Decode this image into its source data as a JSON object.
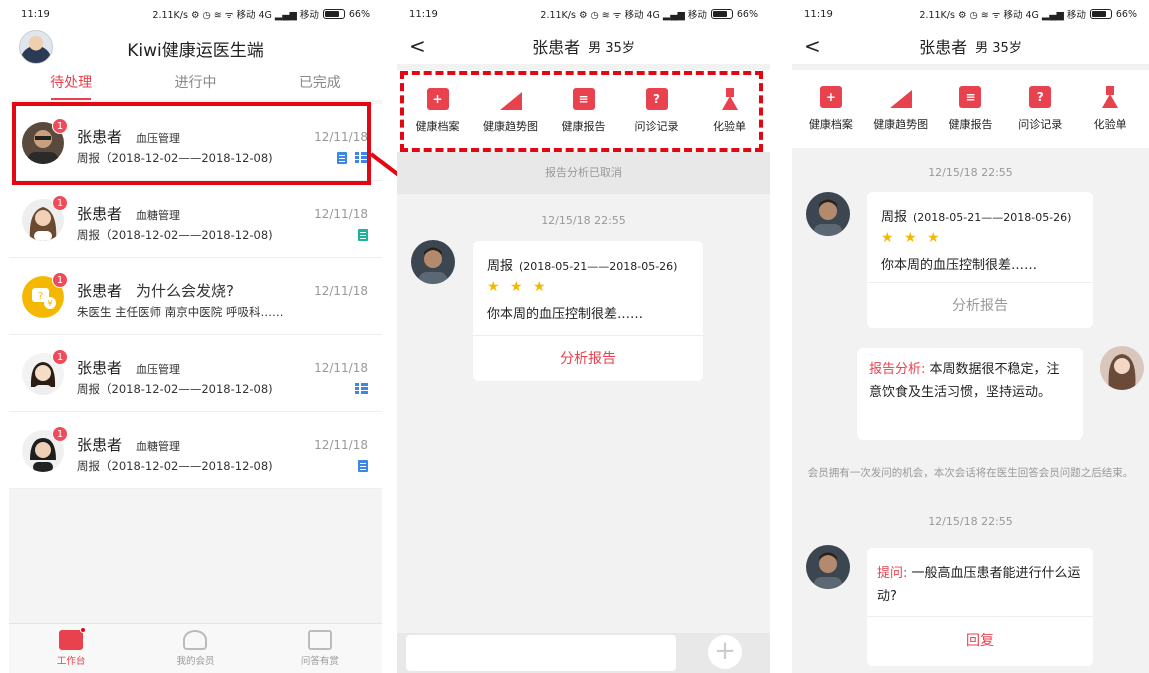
{
  "status": {
    "time": "11:19",
    "right": "2.11K/s ⚙ ◷ ≋ ᯤ 移动 4G ▂▄▆ 移动",
    "battery": "66%"
  },
  "panel1": {
    "title": "Kiwi健康运医生端",
    "tabs": [
      "待处理",
      "进行中",
      "已完成"
    ],
    "rows": [
      {
        "badge": "1",
        "name": "张患者",
        "tag": "血压管理",
        "sub": "周报（2018-12-02——2018-12-08)",
        "date": "12/11/18",
        "icons": [
          "doc-icon",
          "list-icon"
        ]
      },
      {
        "badge": "1",
        "name": "张患者",
        "tag": "血糖管理",
        "sub": "周报（2018-12-02——2018-12-08)",
        "date": "12/11/18",
        "icons": [
          "doc-icon"
        ]
      },
      {
        "badge": "1",
        "name": "张患者",
        "tag": "为什么会发烧?",
        "sub": "朱医生 主任医师 南京中医院 呼吸科……",
        "date": "12/11/18",
        "icons": []
      },
      {
        "badge": "1",
        "name": "张患者",
        "tag": "血压管理",
        "sub": "周报（2018-12-02——2018-12-08)",
        "date": "12/11/18",
        "icons": [
          "list-icon"
        ]
      },
      {
        "badge": "1",
        "name": "张患者",
        "tag": "血糖管理",
        "sub": "周报（2018-12-02——2018-12-08)",
        "date": "12/11/18",
        "icons": [
          "doc-icon"
        ]
      }
    ],
    "nav": [
      "工作台",
      "我的会员",
      "问答有赏"
    ]
  },
  "chat": {
    "back": "<",
    "patient_name": "张患者",
    "patient_info": "男 35岁",
    "tools": [
      "健康档案",
      "健康趋势图",
      "健康报告",
      "问诊记录",
      "化验单"
    ],
    "tool_glyphs": [
      "+",
      "",
      "≡",
      "?",
      ""
    ],
    "plus": "+"
  },
  "panel2": {
    "system_msg": "报告分析已取消",
    "timestamp": "12/15/18 22:55",
    "report_title": "周报",
    "report_range": "(2018-05-21——2018-05-26)",
    "stars": "★ ★ ★",
    "report_text": "你本周的血压控制很差……",
    "report_action": "分析报告"
  },
  "panel3": {
    "timestamp1": "12/15/18 22:55",
    "report_title": "周报",
    "report_range": "(2018-05-21——2018-05-26)",
    "stars": "★ ★ ★",
    "report_text": "你本周的血压控制很差……",
    "report_action": "分析报告",
    "analysis_label": "报告分析:",
    "analysis_text": "本周数据很不稳定，注意饮食及生活习惯，坚持运动。",
    "notice": "会员拥有一次发问的机会，本次会话将在医生回答会员问题之后结束。",
    "timestamp2": "12/15/18 22:55",
    "question_label": "提问:",
    "question_text": "一般高血压患者能进行什么运动?",
    "reply_action": "回复"
  },
  "colors": {
    "accent": "#e8424e",
    "highlight": "#e30613",
    "icon_blue": "#3d86e8",
    "icon_teal": "#19b49a"
  }
}
